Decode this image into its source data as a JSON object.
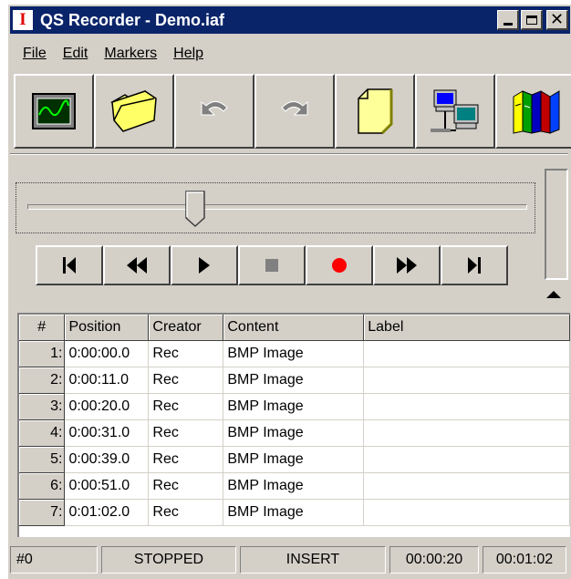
{
  "window": {
    "title": "QS Recorder - Demo.iaf",
    "app_icon_letter": "I"
  },
  "menu": [
    {
      "label": "File"
    },
    {
      "label": "Edit"
    },
    {
      "label": "Markers"
    },
    {
      "label": "Help"
    }
  ],
  "toolbar": {
    "icons": [
      "oscilloscope-icon",
      "open-folder-icon",
      "undo-icon",
      "redo-icon",
      "new-file-icon",
      "network-computers-icon",
      "library-books-icon"
    ]
  },
  "transport": {
    "icons": [
      "skip-to-start-icon",
      "rewind-icon",
      "play-icon",
      "stop-icon",
      "record-icon",
      "fast-forward-icon",
      "skip-to-end-icon"
    ]
  },
  "slider": {
    "position_fraction": 0.33
  },
  "table": {
    "columns": [
      "#",
      "Position",
      "Creator",
      "Content",
      "Label"
    ],
    "rows": [
      {
        "num": "1:",
        "position": "0:00:00.0",
        "creator": "Rec",
        "content": "BMP Image",
        "label": ""
      },
      {
        "num": "2:",
        "position": "0:00:11.0",
        "creator": "Rec",
        "content": "BMP Image",
        "label": ""
      },
      {
        "num": "3:",
        "position": "0:00:20.0",
        "creator": "Rec",
        "content": "BMP Image",
        "label": ""
      },
      {
        "num": "4:",
        "position": "0:00:31.0",
        "creator": "Rec",
        "content": "BMP Image",
        "label": ""
      },
      {
        "num": "5:",
        "position": "0:00:39.0",
        "creator": "Rec",
        "content": "BMP Image",
        "label": ""
      },
      {
        "num": "6:",
        "position": "0:00:51.0",
        "creator": "Rec",
        "content": "BMP Image",
        "label": ""
      },
      {
        "num": "7:",
        "position": "0:01:02.0",
        "creator": "Rec",
        "content": "BMP Image",
        "label": ""
      }
    ]
  },
  "status": {
    "marker": "#0",
    "state": "STOPPED",
    "mode": "INSERT",
    "current_time": "00:00:20",
    "total_time": "00:01:02"
  },
  "colors": {
    "titlebar": "#0a246a",
    "face": "#d4d0c8",
    "record": "#ff0000"
  }
}
